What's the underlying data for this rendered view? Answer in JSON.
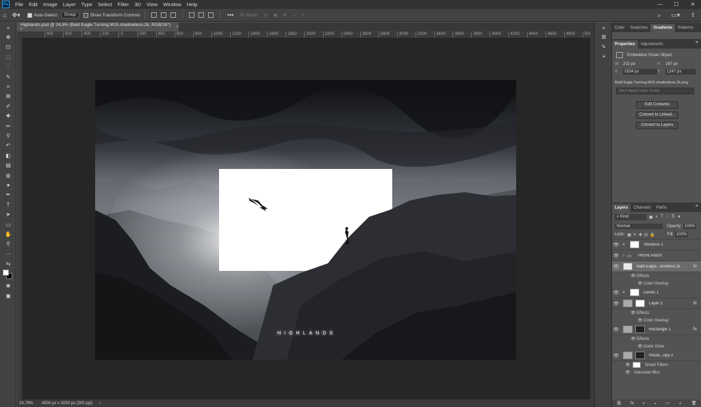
{
  "app": {
    "logo": "Ps"
  },
  "menubar": {
    "items": [
      "File",
      "Edit",
      "Image",
      "Layer",
      "Type",
      "Select",
      "Filter",
      "3D",
      "View",
      "Window",
      "Help"
    ],
    "min": "—",
    "max": "☐",
    "close": "✕"
  },
  "options": {
    "auto_select_label": "Auto-Select:",
    "auto_select_value": "Group",
    "transform_label": "Show Transform Controls",
    "mode3d_label": "3D Mode:",
    "more": "•••"
  },
  "document": {
    "tab_title": "Highlands.psd @ 24,8% (Bald Eagle Turning.M15.shadowless.2k, RGB/16*) *",
    "tab_close": "×",
    "wordmark": "HIGHLANDS"
  },
  "ruler": {
    "ticks": [
      "800",
      "600",
      "400",
      "200",
      "0",
      "200",
      "400",
      "600",
      "800",
      "1000",
      "1200",
      "1400",
      "1600",
      "1800",
      "2000",
      "2200",
      "2400",
      "2600",
      "2800",
      "3000",
      "3200",
      "3400",
      "3600",
      "3800",
      "4000",
      "4200",
      "4400",
      "4600",
      "4800",
      "5000",
      "5200"
    ]
  },
  "status": {
    "zoom": "24,79%",
    "doc_size": "4500 px x 3000 px (300 ppi)",
    "arrow": "›"
  },
  "panels": {
    "top_tabs": [
      "Color",
      "Swatches",
      "Gradients",
      "Patterns"
    ],
    "top_active": "Gradients",
    "prop_tabs": [
      "Properties",
      "Adjustments"
    ],
    "prop_active": "Properties",
    "object_type": "Embedded Smart Object",
    "w_label": "W:",
    "w_value": "202 px",
    "h_label": "H:",
    "h_value": "167 px",
    "x_label": "X:",
    "x_value": "1634 px",
    "y_label": "Y:",
    "y_value": "1247 px",
    "filename": "Bald Eagle Turning.M15.shadowless.2k.png",
    "layer_comp_placeholder": "Don't Apply Layer Comp",
    "btn_edit": "Edit Contents",
    "btn_convert_linked": "Convert to Linked...",
    "btn_convert_layers": "Convert to Layers",
    "layer_tabs": [
      "Layers",
      "Channels",
      "Paths"
    ],
    "layer_active": "Layers",
    "filter_kind": "Kind",
    "blend_mode": "Normal",
    "opacity_label": "Opacity:",
    "opacity_value": "100%",
    "lock_label": "Lock:",
    "fill_label": "Fill:",
    "fill_value": "100%",
    "layers": [
      {
        "name": "Vibrance 2"
      },
      {
        "name": "HIGHLANDS"
      },
      {
        "name": "Bald Eagle...dowless.2k",
        "fx": "fx"
      },
      {
        "name": "Effects"
      },
      {
        "name": "Color Overlay"
      },
      {
        "name": "Levels 1"
      },
      {
        "name": "Layer 2",
        "fx": "fx"
      },
      {
        "name": "Effects"
      },
      {
        "name": "Color Overlay"
      },
      {
        "name": "Rectangle 1",
        "fx": "fx"
      },
      {
        "name": "Effects"
      },
      {
        "name": "Outer Glow"
      },
      {
        "name": "Recta...opy 2"
      },
      {
        "name": "Smart Filters"
      },
      {
        "name": "Gaussian Blur"
      }
    ],
    "bottom_icons": [
      "⛓",
      "fx",
      "◐",
      "◒",
      "▭",
      "＋",
      "🗑"
    ]
  }
}
